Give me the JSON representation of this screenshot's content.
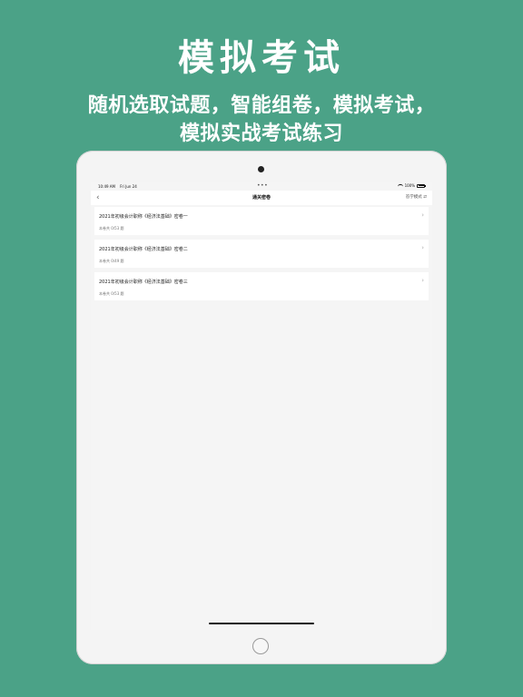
{
  "promo": {
    "title": "模拟考试",
    "subtitle_line1": "随机选取试题，智能组卷，模拟考试，",
    "subtitle_line2": "模拟实战考试练习"
  },
  "status_bar": {
    "time": "10:49 AM",
    "date": "Fri Jun 24",
    "dots": "•••",
    "battery": "100%"
  },
  "nav": {
    "back_icon": "chevron-left",
    "title": "通关密卷",
    "right_action": "答学模式 ⇄"
  },
  "papers": [
    {
      "title": "2021年初级会计职称《经济法基础》密卷一",
      "progress": "本卷共 0/53 题"
    },
    {
      "title": "2021年初级会计职称《经济法基础》密卷二",
      "progress": "本卷共 0/49 题"
    },
    {
      "title": "2021年初级会计职称《经济法基础》密卷三",
      "progress": "本卷共 0/53 题"
    }
  ],
  "colors": {
    "background": "#4ba287",
    "text_primary": "#ffffff"
  }
}
